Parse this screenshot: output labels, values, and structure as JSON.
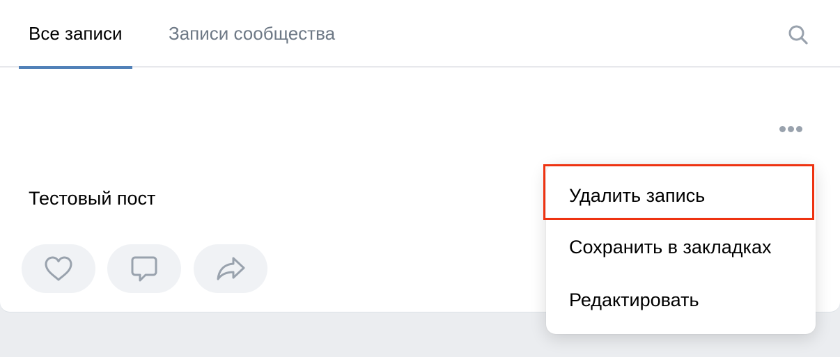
{
  "tabs": {
    "all_posts": "Все записи",
    "community_posts": "Записи сообщества"
  },
  "icons": {
    "search": "search-icon",
    "more": "more-horizontal-icon",
    "like": "heart-icon",
    "comment": "comment-icon",
    "share": "share-icon"
  },
  "post": {
    "text": "Тестовый пост"
  },
  "menu": {
    "delete": "Удалить запись",
    "bookmark": "Сохранить в закладках",
    "edit": "Редактировать"
  },
  "colors": {
    "accent": "#5181b8",
    "highlight": "#ee3311",
    "icon": "#99a2ad",
    "action_bg": "#f0f2f5"
  }
}
